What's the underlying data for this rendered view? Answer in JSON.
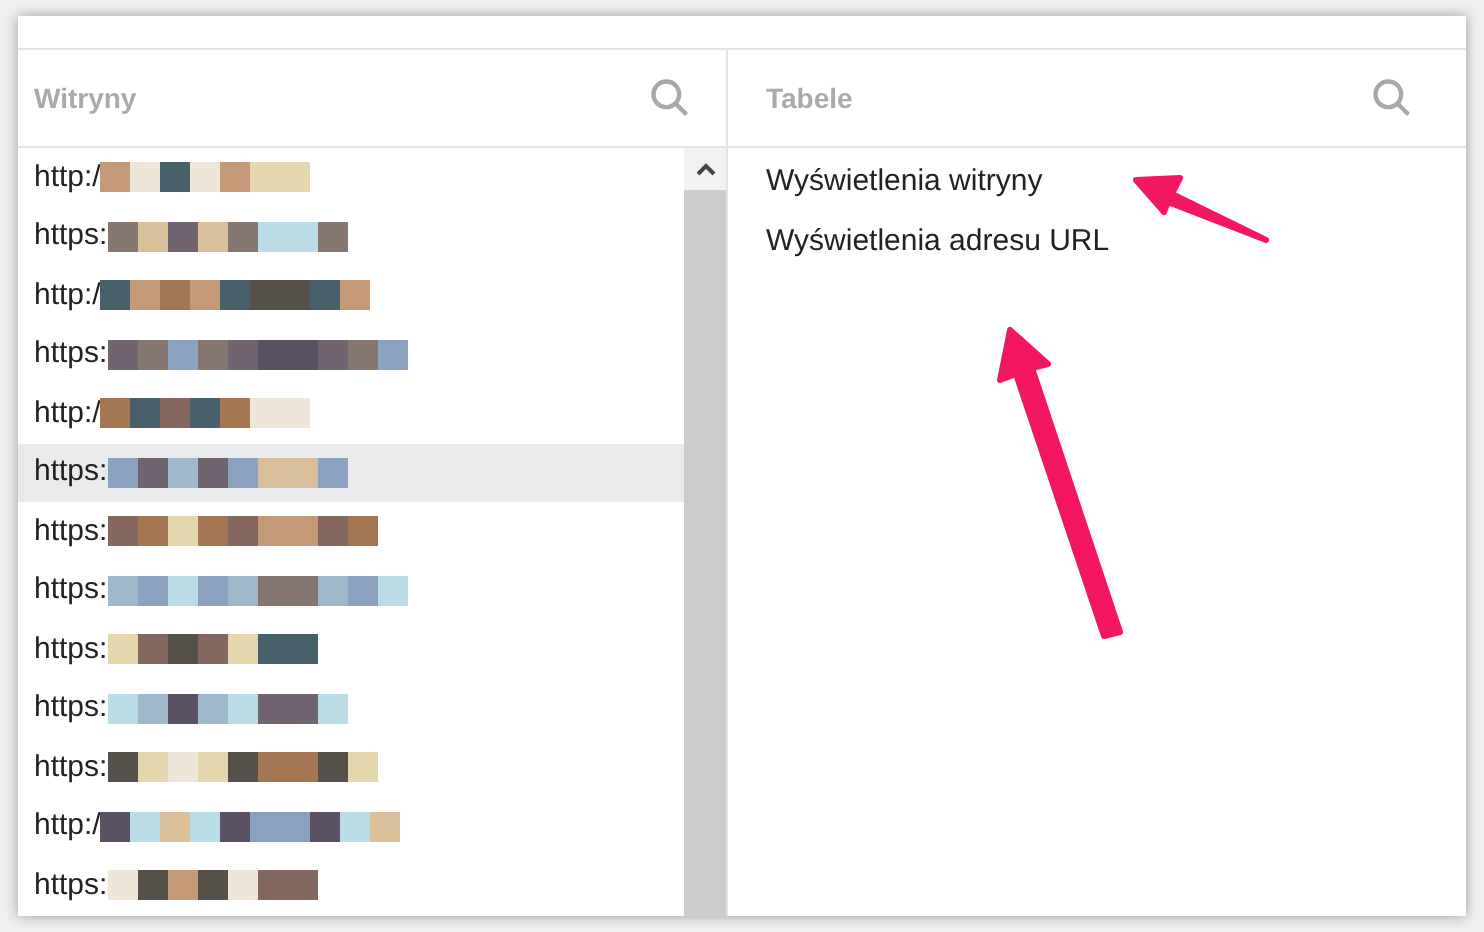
{
  "sites_panel": {
    "search_placeholder": "Witryny",
    "rows": [
      {
        "text": "http:/",
        "selected": false,
        "redacted": true
      },
      {
        "text": "https:",
        "selected": false,
        "redacted": true
      },
      {
        "text": "http:/",
        "selected": false,
        "redacted": true
      },
      {
        "text": "https:",
        "selected": false,
        "redacted": true
      },
      {
        "text": "http:/",
        "selected": false,
        "redacted": true
      },
      {
        "text": "https:",
        "selected": true,
        "redacted": true
      },
      {
        "text": "https:",
        "selected": false,
        "redacted": true
      },
      {
        "text": "https:",
        "selected": false,
        "redacted": true
      },
      {
        "text": "https:",
        "selected": false,
        "redacted": true
      },
      {
        "text": "https:",
        "selected": false,
        "redacted": true
      },
      {
        "text": "https:",
        "selected": false,
        "redacted": true
      },
      {
        "text": "http:/",
        "selected": false,
        "redacted": true
      },
      {
        "text": "https:",
        "selected": false,
        "redacted": true
      }
    ]
  },
  "tables_panel": {
    "search_placeholder": "Tabele",
    "items": [
      {
        "text": "Wyświetlenia witryny",
        "selected": false
      },
      {
        "text": "Wyświetlenia adresu URL",
        "selected": false
      }
    ]
  },
  "annotations": [
    {
      "kind": "arrow"
    },
    {
      "kind": "arrow"
    }
  ]
}
